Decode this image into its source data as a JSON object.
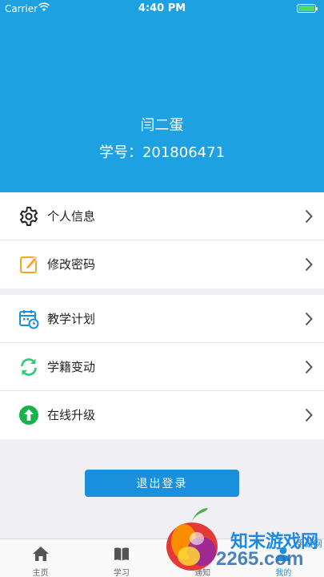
{
  "status_bar": {
    "carrier": "Carrier",
    "time": "4:40 PM"
  },
  "profile": {
    "name": "闫二蛋",
    "student_id": "学号：201806471"
  },
  "menu": {
    "group1": [
      {
        "label": "个人信息",
        "icon": "gear-icon",
        "color": "#222222"
      },
      {
        "label": "修改密码",
        "icon": "edit-icon",
        "color": "#f5a623"
      }
    ],
    "group2": [
      {
        "label": "教学计划",
        "icon": "calendar-icon",
        "color": "#1a8fdc"
      },
      {
        "label": "学籍变动",
        "icon": "refresh-icon",
        "color": "#2ecc71"
      },
      {
        "label": "在线升级",
        "icon": "upload-icon",
        "color": "#16b24a"
      }
    ]
  },
  "logout": {
    "label": "退出登录"
  },
  "tabs": [
    {
      "label": "主页",
      "icon": "home-icon"
    },
    {
      "label": "学习",
      "icon": "book-icon"
    },
    {
      "label": "通知",
      "icon": "bell-icon"
    },
    {
      "label": "我的",
      "icon": "person-icon",
      "active": true
    }
  ],
  "watermark": {
    "line1": "知末游戏网",
    "line2": "2265.com",
    "line3": "手游网"
  },
  "colors": {
    "header": "#1da1e3",
    "accent": "#1a8fdc",
    "background": "#efeff4"
  }
}
